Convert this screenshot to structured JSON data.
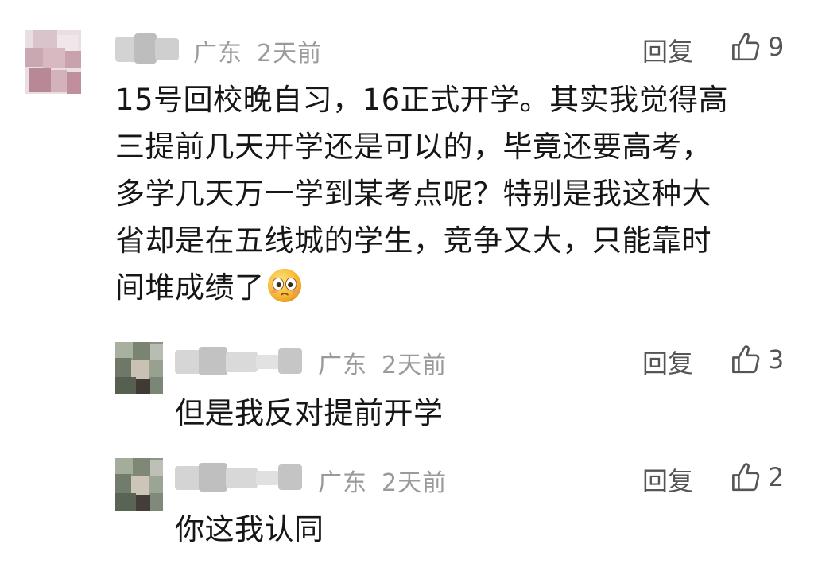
{
  "main_comment": {
    "location": "广东",
    "time": "2天前",
    "reply_label": "回复",
    "like_count": "9",
    "text_lines": [
      "15号回校晚自习，16正式开学。其实我觉得高",
      "三提前几天开学还是可以的，毕竟还要高考，",
      "多学几天万一学到某考点呢？特别是我这种大",
      "省却是在五线城的学生，竞争又大，只能靠时",
      "间堆成绩了"
    ],
    "emoji": "flushed-face-emoji"
  },
  "replies": [
    {
      "location": "广东",
      "time": "2天前",
      "reply_label": "回复",
      "like_count": "3",
      "text": "但是我反对提前开学"
    },
    {
      "location": "广东",
      "time": "2天前",
      "reply_label": "回复",
      "like_count": "2",
      "text": "你这我认同"
    }
  ],
  "icons": {
    "like": "thumbs-up-icon"
  },
  "colors": {
    "meta_gray": "#9a9a9a",
    "action_gray": "#555555",
    "text": "#161616"
  }
}
